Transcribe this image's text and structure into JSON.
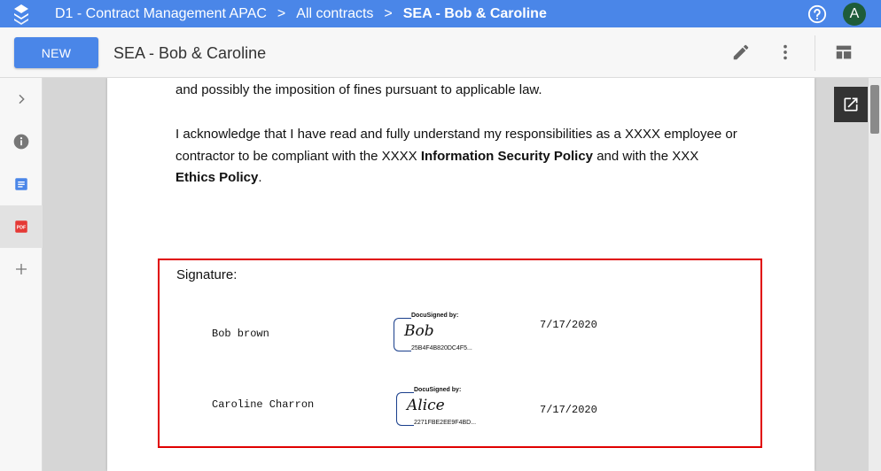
{
  "topbar": {
    "breadcrumbs": [
      "D1 - Contract Management APAC",
      "All contracts",
      "SEA - Bob & Caroline"
    ],
    "avatar_letter": "A",
    "bar_color": "#4a86e8"
  },
  "toolbar": {
    "new_label": "NEW",
    "document_title": "SEA - Bob & Caroline"
  },
  "rail": {
    "items": [
      "chevron-right-icon",
      "info-icon",
      "document-icon",
      "pdf-icon",
      "plus-icon"
    ],
    "pdf_label": "PDF"
  },
  "document": {
    "line_top": "and possibly the imposition of fines pursuant to applicable law.",
    "ack_line1": "I acknowledge that I have read and fully understand my responsibilities as a XXXX employee or",
    "ack_line2_pre": "contractor to be compliant with the XXXX ",
    "ack_line2_bold": "Information Security Policy",
    "ack_line2_post": " and with the XXX",
    "ack_line3_bold": "Ethics Policy",
    "ack_line3_post": ".",
    "signature_label": "Signature:",
    "signers": [
      {
        "name": "Bob brown",
        "stamp_header": "DocuSigned by:",
        "signature": "Bob",
        "hash": "25B4F4B820DC4F5...",
        "date": "7/17/2020"
      },
      {
        "name": "Caroline Charron",
        "stamp_header": "DocuSigned by:",
        "signature": "Alice",
        "hash": "2271FBE2EE9F4BD...",
        "date": "7/17/2020"
      }
    ]
  },
  "colors": {
    "accent": "#4a86e8",
    "highlight_box": "#e00000",
    "avatar": "#1e5c3a"
  }
}
